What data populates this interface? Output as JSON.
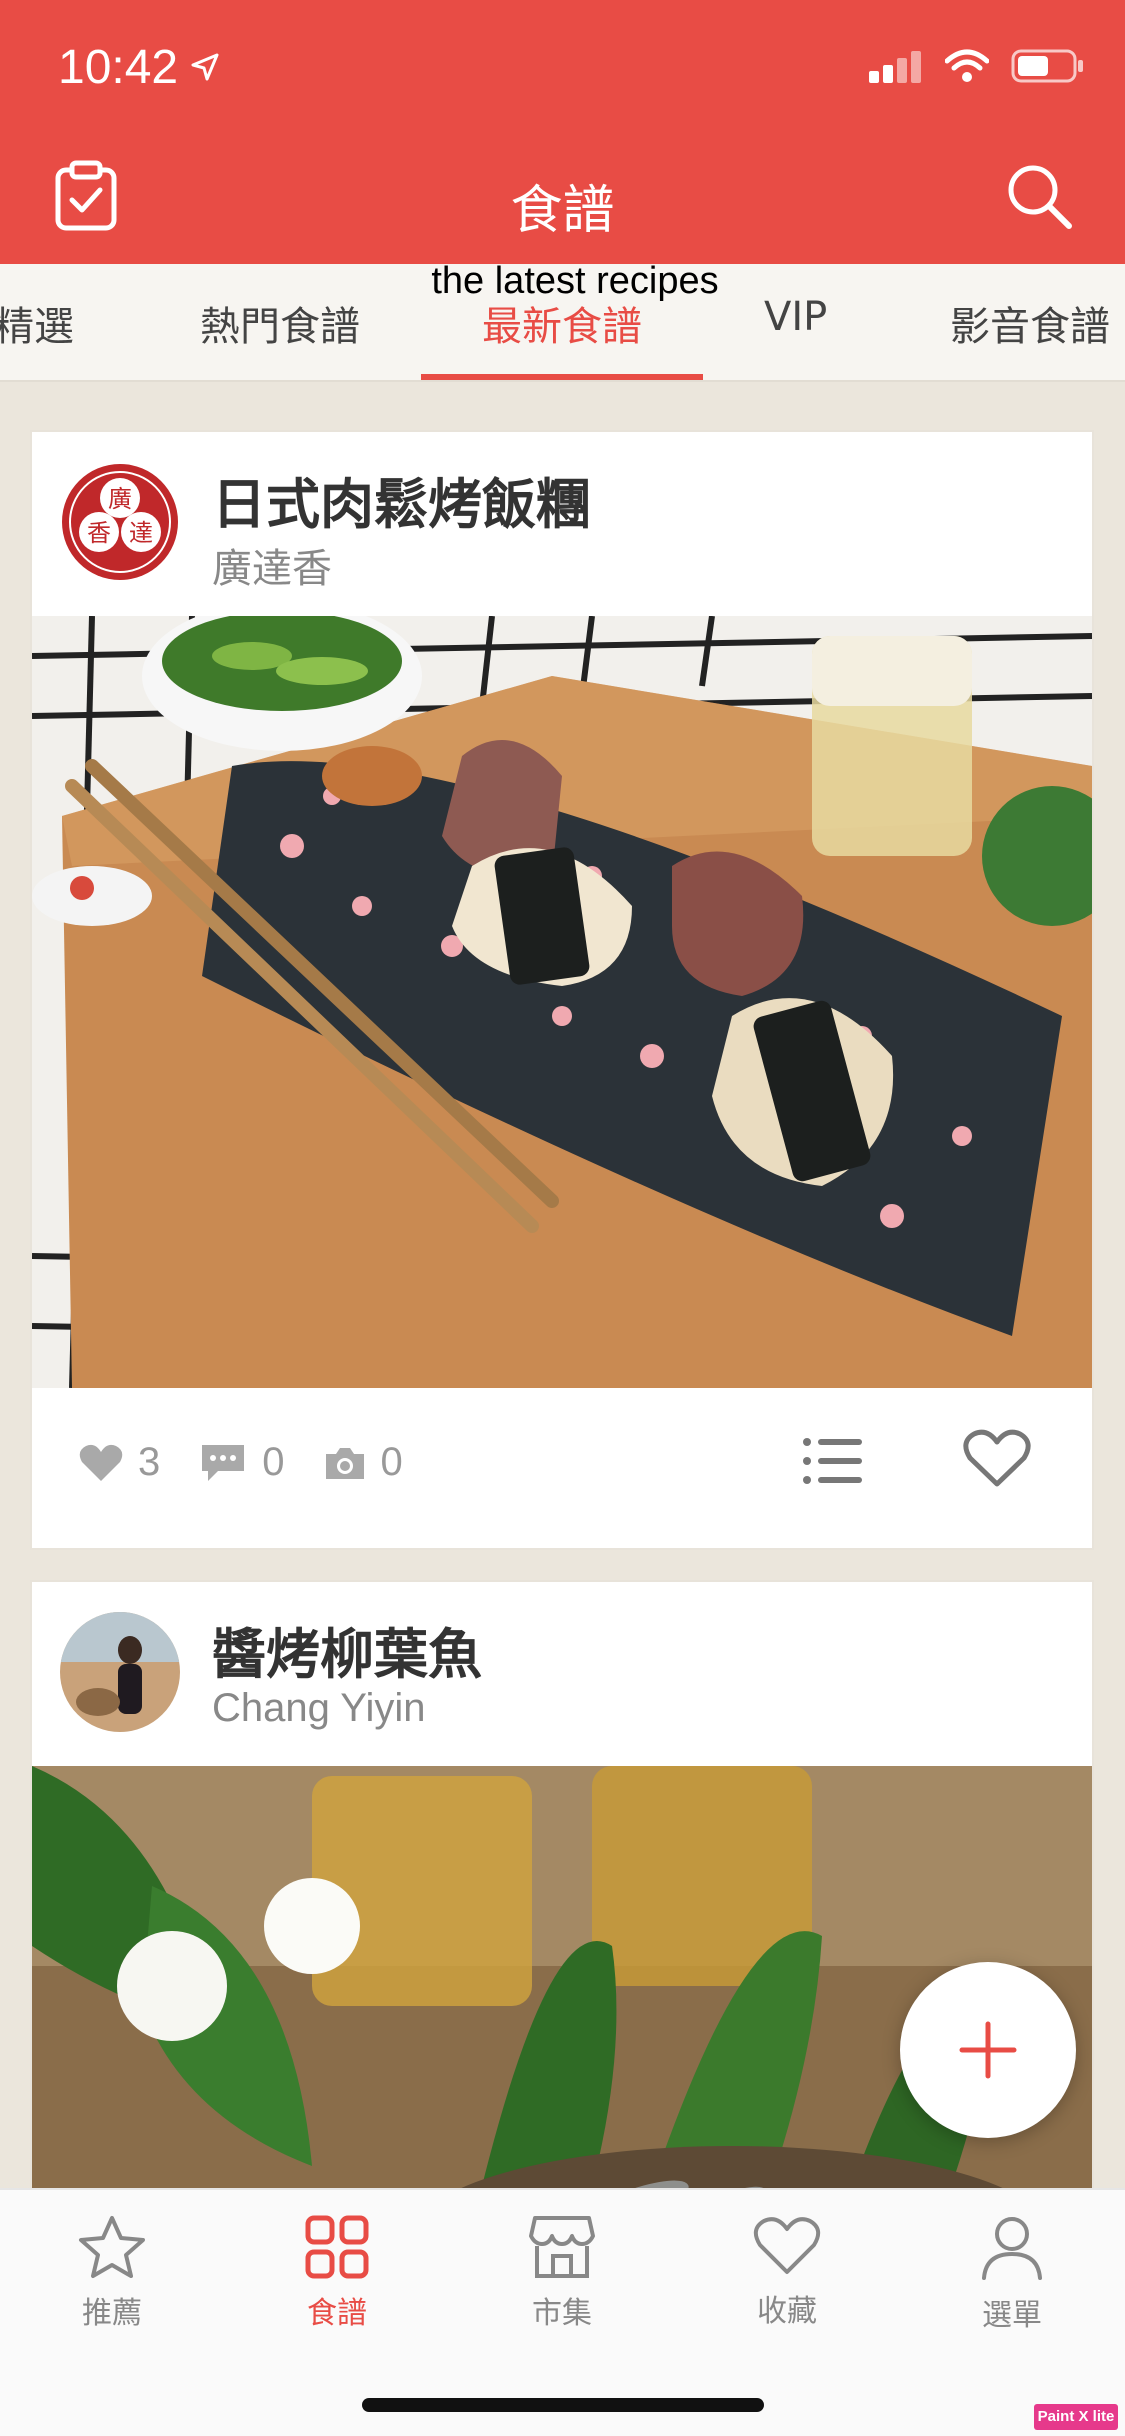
{
  "status_bar": {
    "time": "10:42"
  },
  "header": {
    "title": "食譜"
  },
  "tabs": {
    "items": [
      "精選",
      "熱門食譜",
      "最新食譜",
      "VIP",
      "影音食譜"
    ],
    "active": "最新食譜",
    "caption": "the latest recipes"
  },
  "recipes": [
    {
      "title": "日式肉鬆烤飯糰",
      "author": "廣達香",
      "logo_text": [
        "廣",
        "香",
        "達"
      ],
      "likes": "3",
      "comments": "0",
      "photos": "0"
    },
    {
      "title": "醬烤柳葉魚",
      "author": "Chang Yiyin"
    }
  ],
  "bottom_nav": [
    {
      "label": "推薦",
      "icon": "star-icon"
    },
    {
      "label": "食譜",
      "icon": "grid-icon"
    },
    {
      "label": "市集",
      "icon": "store-icon"
    },
    {
      "label": "收藏",
      "icon": "heart-icon"
    },
    {
      "label": "選單",
      "icon": "person-icon"
    }
  ],
  "watermark": "Paint X lite",
  "colors": {
    "accent": "#e84c45",
    "background": "#ebe6dc"
  }
}
